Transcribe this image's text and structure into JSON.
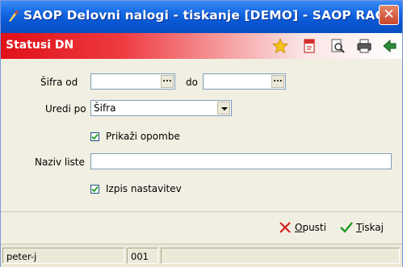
{
  "window": {
    "title": "SAOP Delovni nalogi - tiskanje [DEMO] - SAOP RAČ...",
    "close_label": "✕"
  },
  "header": {
    "title": "Statusi DN",
    "toolbar_icons": [
      "star-icon",
      "pdf-icon",
      "print-preview-icon",
      "printer-icon",
      "exit-icon"
    ]
  },
  "form": {
    "sifra_od_label": "Šifra od",
    "sifra_od_value": "",
    "sifra_do_label": "do",
    "sifra_do_value": "",
    "lookup_button": "...",
    "uredi_po_label": "Uredi po",
    "uredi_po_value": "Šifra",
    "prikazi_opombe_label": "Prikaži opombe",
    "prikazi_opombe_checked": true,
    "naziv_liste_label": "Naziv liste",
    "naziv_liste_value": "",
    "izpis_nastavitev_label": "Izpis nastavitev",
    "izpis_nastavitev_checked": true
  },
  "actions": {
    "cancel_label": "Opusti",
    "print_label": "Tiskaj"
  },
  "statusbar": {
    "user": "peter-j",
    "code": "001",
    "extra": ""
  },
  "colors": {
    "title_blue": "#0a59d6",
    "header_red": "#e01018",
    "window_bg": "#f1efe2"
  }
}
